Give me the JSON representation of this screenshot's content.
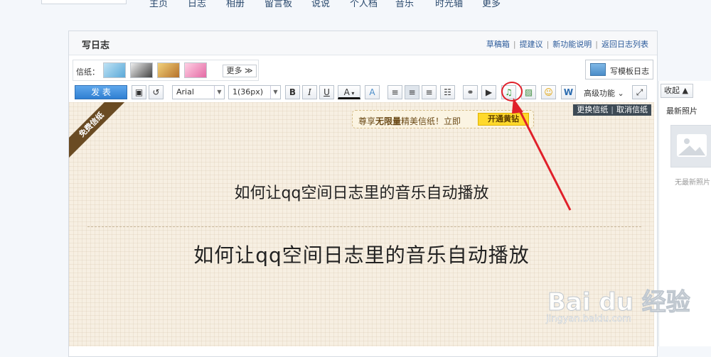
{
  "nav": {
    "items": [
      "主页",
      "日志",
      "相册",
      "留言板",
      "说说",
      "个人档",
      "音乐",
      "时光轴",
      "更多"
    ]
  },
  "panel": {
    "title": "写日志",
    "links": [
      "草稿箱",
      "提建议",
      "新功能说明",
      "返回日志列表"
    ]
  },
  "paper": {
    "label": "信纸：",
    "more_label": "更多 ≫",
    "template_label": "写模板日志"
  },
  "toolbar": {
    "publish_label": "发 表",
    "font_name": "Arial",
    "font_size": "1(36px)",
    "bold": "B",
    "italic": "I",
    "underline": "U",
    "font_color": "A",
    "advanced_label": "高级功能 ⌄"
  },
  "editor": {
    "ribbon": "免费信纸",
    "promo_text_pre": "尊享",
    "promo_text_bold": "无限量",
    "promo_text_post": "精美信纸！立即",
    "promo_button": "开通黄钻",
    "paper_actions": [
      "更换信纸",
      "取消信纸"
    ],
    "title": "如何让qq空间日志里的音乐自动播放",
    "body": "如何让qq空间日志里的音乐自动播放"
  },
  "sidebar": {
    "collapse_label": "收起 ▲",
    "latest_label": "最新照片",
    "no_photo": "无最新照片"
  },
  "watermark": {
    "main": "Bai du 经验",
    "sub": "jingyan.baidu.com"
  },
  "colors": {
    "highlight": "#e0202a",
    "publish": "#2f7fd2",
    "promo": "#ffd92b"
  }
}
